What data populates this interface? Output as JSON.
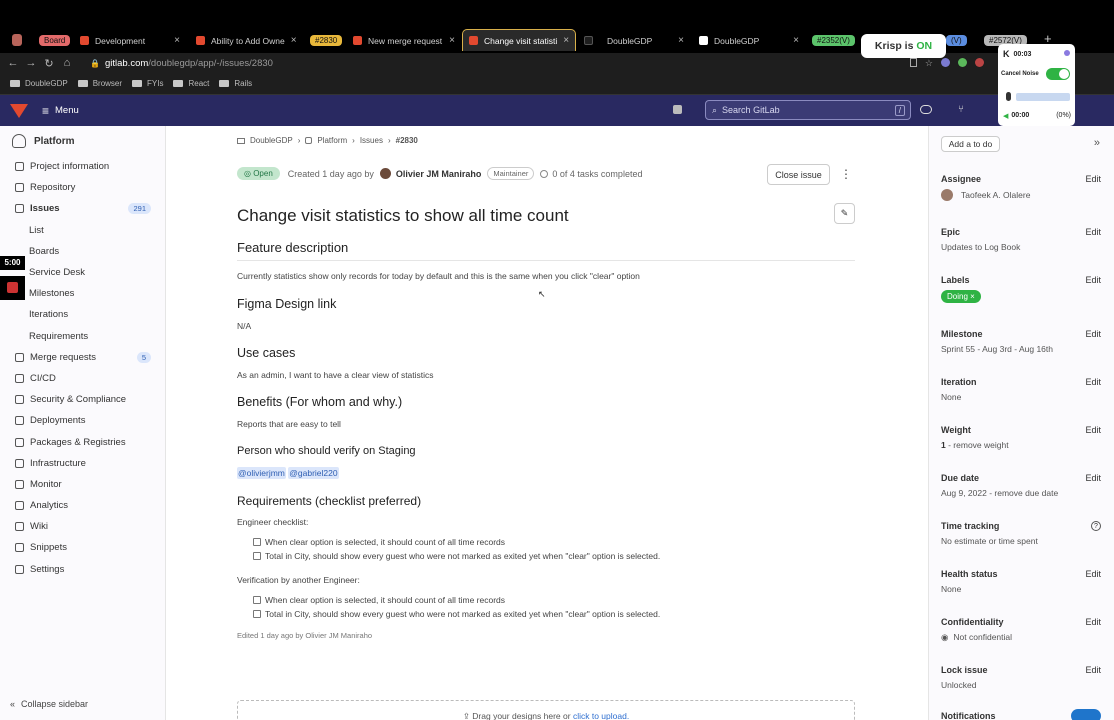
{
  "browser": {
    "tabs": [
      {
        "label": "Board",
        "pill": true,
        "color": "#e36a6a"
      },
      {
        "label": "Development"
      },
      {
        "label": "Ability to Add Owne"
      },
      {
        "label": "#2830",
        "pill": true,
        "color": "#e8b83b"
      },
      {
        "label": "New merge request"
      },
      {
        "label": "Change visit statisti",
        "active": true
      },
      {
        "label": "DoubleGDP"
      },
      {
        "label": "DoubleGDP"
      },
      {
        "label": "#2352(V)",
        "pill": true,
        "color": "#5cc46b"
      },
      {
        "label": "(V)",
        "pill": true,
        "color": "#5b8de0"
      },
      {
        "label": "#2572(V)",
        "pill": true,
        "color": "#b8b8b8"
      }
    ],
    "url_domain": "gitlab.com",
    "url_path": "/doublegdp/app/-/issues/2830",
    "bookmarks": [
      "DoubleGDP",
      "Browser",
      "FYIs",
      "React",
      "Rails"
    ]
  },
  "krisp": {
    "label": "Krisp is",
    "state": "ON",
    "timer1": "00:03",
    "cancel_noise": "Cancel Noise",
    "timer2": "00:00",
    "percent": "(0%)"
  },
  "recording": {
    "time": "5:00"
  },
  "header": {
    "menu_label": "Menu",
    "search_placeholder": "Search GitLab",
    "search_shortcut": "/"
  },
  "sidebar": {
    "project": "Platform",
    "items": [
      {
        "label": "Project information"
      },
      {
        "label": "Repository"
      },
      {
        "label": "Issues",
        "badge": "291",
        "bold": true
      },
      {
        "label": "List",
        "sub": true
      },
      {
        "label": "Boards",
        "sub": true
      },
      {
        "label": "Service Desk",
        "sub": true
      },
      {
        "label": "Milestones",
        "sub": true
      },
      {
        "label": "Iterations",
        "sub": true
      },
      {
        "label": "Requirements",
        "sub": true
      },
      {
        "label": "Merge requests",
        "badge": "5"
      },
      {
        "label": "CI/CD"
      },
      {
        "label": "Security & Compliance"
      },
      {
        "label": "Deployments"
      },
      {
        "label": "Packages & Registries"
      },
      {
        "label": "Infrastructure"
      },
      {
        "label": "Monitor"
      },
      {
        "label": "Analytics"
      },
      {
        "label": "Wiki"
      },
      {
        "label": "Snippets"
      },
      {
        "label": "Settings"
      }
    ],
    "collapse_label": "Collapse sidebar"
  },
  "issue": {
    "breadcrumb": [
      "DoubleGDP",
      "Platform",
      "Issues",
      "#2830"
    ],
    "status": "Open",
    "created": "Created 1 day ago by",
    "author": "Olivier JM Maniraho",
    "role": "Maintainer",
    "tasks": "0 of 4 tasks completed",
    "close_label": "Close issue",
    "title": "Change visit statistics to show all time count",
    "feature_heading": "Feature description",
    "feature_text": "Currently statistics show only records for today by default and this is the same when you click \"clear\" option",
    "figma_heading": "Figma Design link",
    "figma_text": "N/A",
    "use_heading": "Use cases",
    "use_text": "As an admin, I want to have a clear view of statistics",
    "benefit_heading": "Benefits (For whom and why.)",
    "benefit_text": "Reports that are easy to tell",
    "verify_heading": "Person who should verify on Staging",
    "mention1": "@olivierjmm",
    "mention2": "@gabriel220",
    "req_heading": "Requirements (checklist preferred)",
    "eng_label": "Engineer checklist:",
    "eng_items": [
      "When clear option is selected, it should count of all time records",
      "Total in City, should show every guest who were not marked as exited yet when \"clear\" option is selected."
    ],
    "ver_label": "Verification by another Engineer:",
    "ver_items": [
      "When clear option is selected, it should count of all time records",
      "Total in City, should show every guest who were not marked as exited yet when \"clear\" option is selected."
    ],
    "edited": "Edited 1 day ago by Olivier JM Maniraho",
    "drop_text": "Drag your designs here or",
    "drop_link": "click to upload."
  },
  "rsidebar": {
    "todo_label": "Add a to do",
    "edit": "Edit",
    "assignee_label": "Assignee",
    "assignee": "Taofeek A. Olalere",
    "epic_label": "Epic",
    "epic": "Updates to Log Book",
    "labels_label": "Labels",
    "label_tag": "Doing",
    "milestone_label": "Milestone",
    "milestone": "Sprint 55 - Aug 3rd - Aug 16th",
    "iteration_label": "Iteration",
    "iteration": "None",
    "weight_label": "Weight",
    "weight": "1",
    "weight_rm": "- remove weight",
    "due_label": "Due date",
    "due": "Aug 9, 2022 - remove due date",
    "time_label": "Time tracking",
    "time": "No estimate or time spent",
    "health_label": "Health status",
    "health": "None",
    "conf_label": "Confidentiality",
    "conf": "Not confidential",
    "lock_label": "Lock issue",
    "lock": "Unlocked",
    "notif_label": "Notifications"
  }
}
